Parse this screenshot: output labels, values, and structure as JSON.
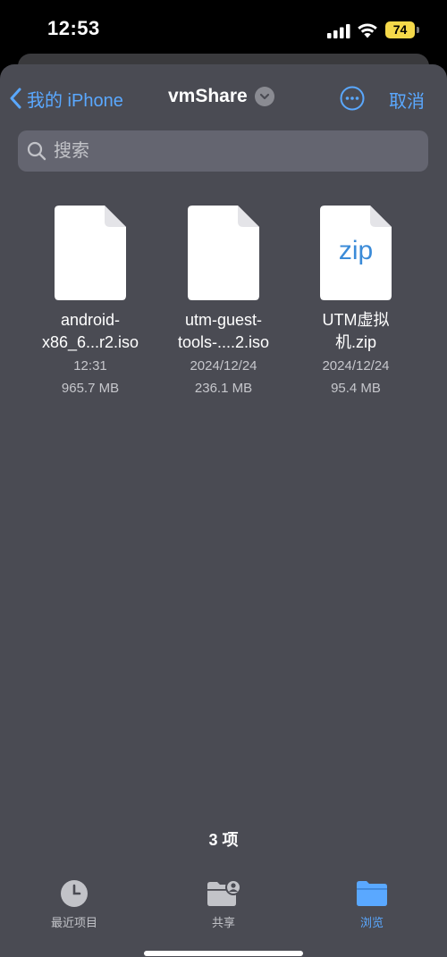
{
  "status": {
    "time": "12:53",
    "battery": "74"
  },
  "nav": {
    "back_label": "我的 iPhone",
    "title": "vmShare",
    "cancel_label": "取消"
  },
  "search": {
    "placeholder": "搜索"
  },
  "files": [
    {
      "name": "android-\nx86_6...r2.iso",
      "date": "12:31",
      "size": "965.7 MB",
      "icon": "document-icon"
    },
    {
      "name": "utm-guest-\ntools-....2.iso",
      "date": "2024/12/24",
      "size": "236.1 MB",
      "icon": "document-icon"
    },
    {
      "name": "UTM虚拟\n机.zip",
      "date": "2024/12/24",
      "size": "95.4 MB",
      "icon": "zip-document-icon",
      "badge": "zip"
    }
  ],
  "footer": {
    "count": "3 项"
  },
  "tabs": [
    {
      "label": "最近项目",
      "icon": "clock-icon"
    },
    {
      "label": "共享",
      "icon": "shared-folder-icon"
    },
    {
      "label": "浏览",
      "icon": "folder-icon",
      "active": true
    }
  ],
  "colors": {
    "accent": "#5aa8ff",
    "sheet": "#4a4b53",
    "battery": "#f5d94a"
  }
}
